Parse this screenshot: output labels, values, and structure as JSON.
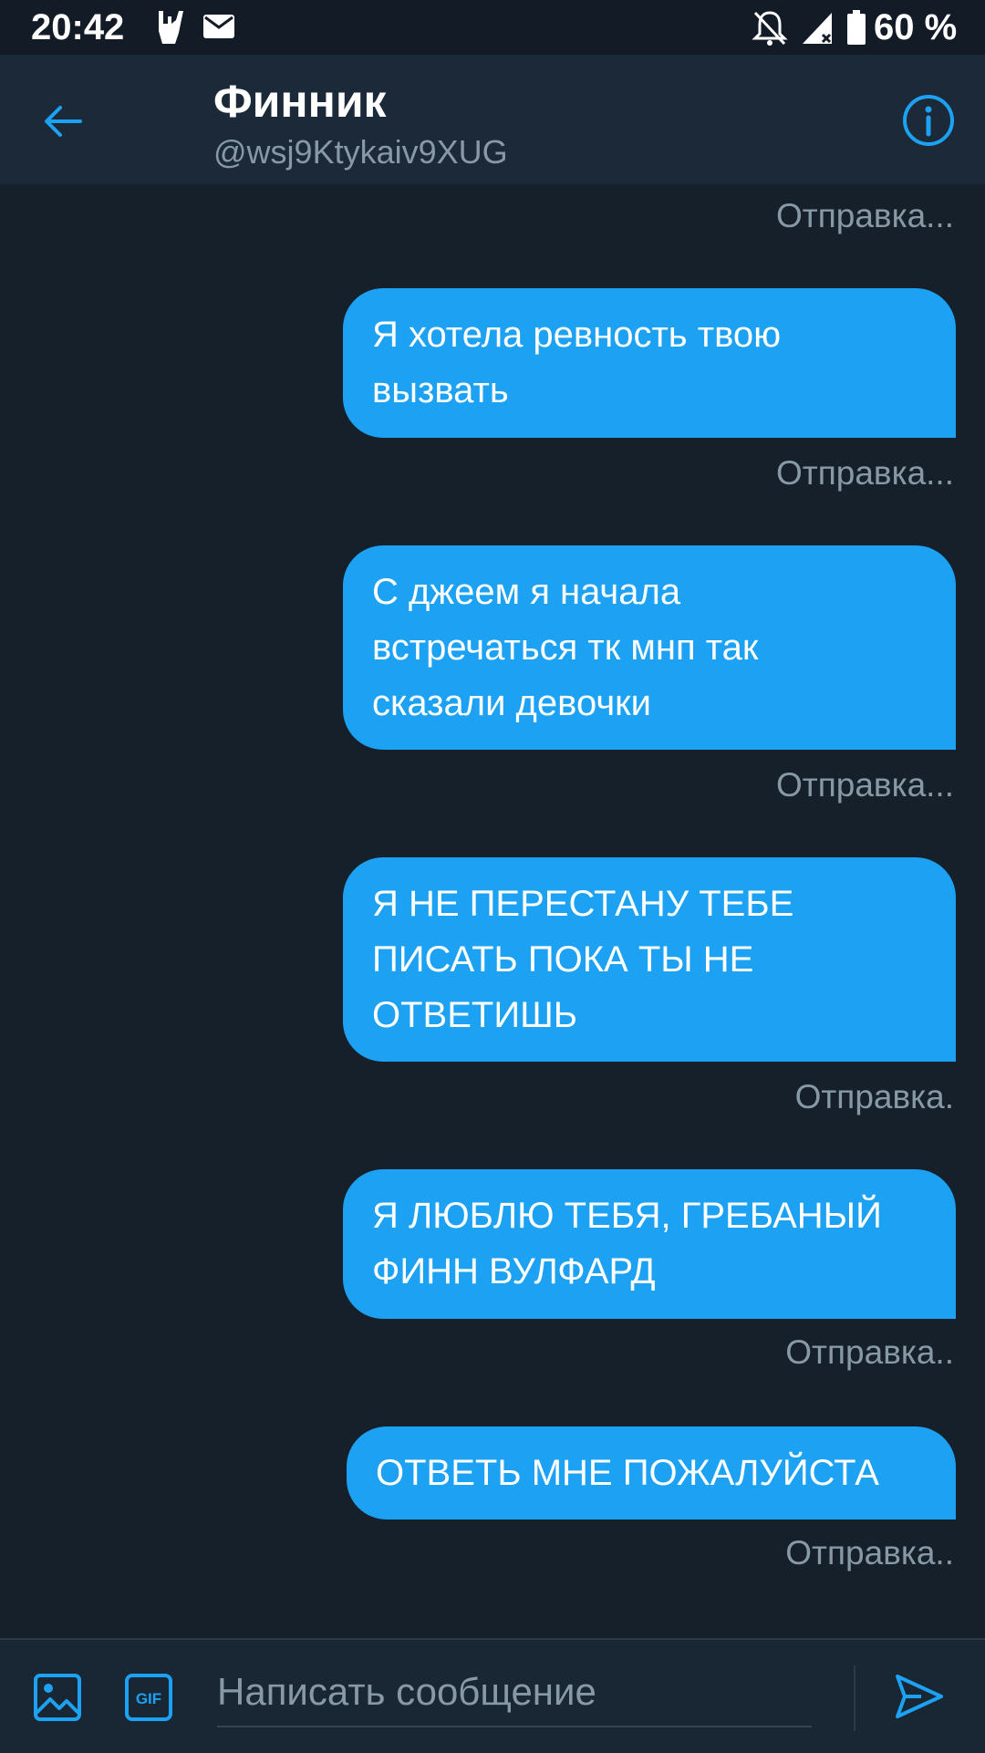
{
  "status_bar": {
    "time": "20:42",
    "icons": [
      "hand-sign-icon",
      "mail-icon",
      "bell-off-icon",
      "signal-icon",
      "battery-icon"
    ],
    "battery": "60 %"
  },
  "header": {
    "name": "Финник",
    "handle": "@wsj9Ktykaiv9XUG",
    "back_icon": "arrow-left-icon",
    "info_icon": "info-icon"
  },
  "messages": [
    {
      "status": "Отправка..."
    },
    {
      "text": "Я хотела ревность твою\nвызвать",
      "status": "Отправка..."
    },
    {
      "text": "С джеем я начала\nвстречаться тк мнп так\nсказали девочки",
      "status": "Отправка..."
    },
    {
      "text": "Я НЕ ПЕРЕСТАНУ ТЕБЕ\nПИСАТЬ ПОКА ТЫ НЕ\nОТВЕТИШЬ",
      "status": "Отправка."
    },
    {
      "text": "Я ЛЮБЛЮ ТЕБЯ, ГРЕБАНЫЙ\nФИНН ВУЛФАРД",
      "status": "Отправка.."
    },
    {
      "text": "ОТВЕТЬ МНЕ ПОЖАЛУЙСТА",
      "status": "Отправка.."
    }
  ],
  "composer": {
    "placeholder": "Написать сообщение",
    "value": "",
    "image_icon": "image-icon",
    "gif_icon": "gif-icon",
    "send_icon": "send-icon"
  },
  "colors": {
    "background": "#15202b",
    "header": "#1c2938",
    "accent": "#1da1f2",
    "muted_text": "#8899a6"
  }
}
